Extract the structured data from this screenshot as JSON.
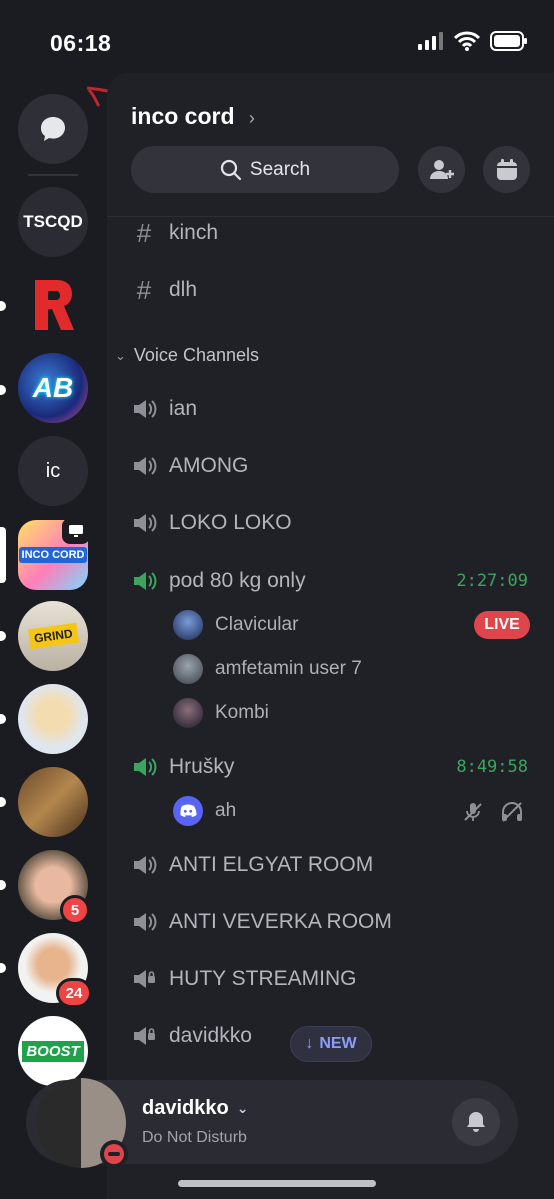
{
  "status_bar": {
    "time": "06:18"
  },
  "sidebar": {
    "servers": [
      {
        "label": "",
        "kind": "dm"
      },
      {
        "label": "TSCQD"
      },
      {
        "label": "R"
      },
      {
        "label": "AB"
      },
      {
        "label": "ic"
      },
      {
        "label": "INCO CORD"
      },
      {
        "label": "GRIND"
      },
      {
        "label": ""
      },
      {
        "label": ""
      },
      {
        "label": "",
        "badge": "5"
      },
      {
        "label": "",
        "badge": "24"
      },
      {
        "label": "BOOST"
      }
    ]
  },
  "server": {
    "name": "inco cord"
  },
  "search": {
    "label": "Search"
  },
  "channels": {
    "text": [
      {
        "name": "kinch"
      },
      {
        "name": "dlh"
      }
    ],
    "voice_category": "Voice Channels",
    "voice": [
      {
        "name": "ian"
      },
      {
        "name": "AMONG"
      },
      {
        "name": "LOKO LOKO"
      },
      {
        "name": "pod 80 kg only",
        "timer": "2:27:09",
        "users": [
          {
            "name": "Clavicular",
            "badge": "LIVE"
          },
          {
            "name": "amfetamin user 7"
          },
          {
            "name": "Kombi"
          }
        ]
      },
      {
        "name": "Hrušky",
        "timer": "8:49:58",
        "users": [
          {
            "name": "ah"
          }
        ]
      },
      {
        "name": "ANTI ELGYAT ROOM"
      },
      {
        "name": "ANTI VEVERKA ROOM"
      },
      {
        "name": "HUTY STREAMING"
      },
      {
        "name": "davidkko"
      }
    ],
    "new_label": "NEW"
  },
  "user_panel": {
    "username": "davidkko",
    "status": "Do Not Disturb"
  },
  "colors": {
    "accent": "#5865f2",
    "voice_active": "#3ba55d",
    "live": "#e0454b"
  }
}
